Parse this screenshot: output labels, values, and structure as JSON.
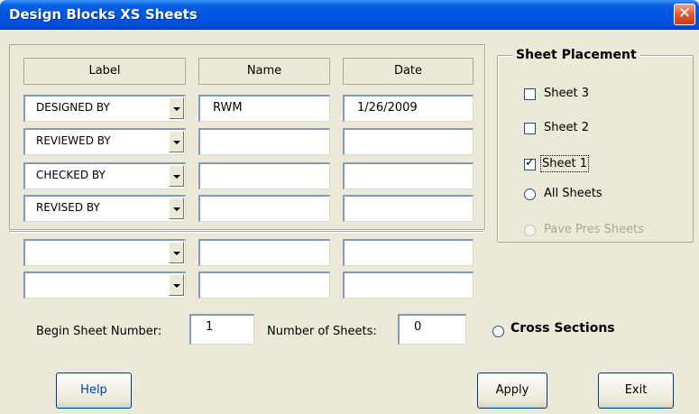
{
  "window": {
    "title": "Design Blocks XS Sheets",
    "close_glyph": "✕"
  },
  "columns": {
    "label": "Label",
    "name": "Name",
    "date": "Date"
  },
  "rows": [
    {
      "label": "DESIGNED BY",
      "name": "RWM",
      "date": "1/26/2009"
    },
    {
      "label": "REVIEWED BY",
      "name": "",
      "date": ""
    },
    {
      "label": "CHECKED BY",
      "name": "",
      "date": ""
    },
    {
      "label": "REVISED BY",
      "name": "",
      "date": ""
    },
    {
      "label": "",
      "name": "",
      "date": ""
    },
    {
      "label": "",
      "name": "",
      "date": ""
    }
  ],
  "placement": {
    "title": "Sheet Placement",
    "sheet3": {
      "label": "Sheet 3",
      "checked": false
    },
    "sheet2": {
      "label": "Sheet 2",
      "checked": false
    },
    "sheet1": {
      "label": "Sheet 1",
      "checked": true
    },
    "all_sheets": {
      "label": "All Sheets"
    },
    "pave_pres": {
      "label": "Pave Pres Sheets",
      "enabled": false
    }
  },
  "begin_sheet": {
    "label": "Begin Sheet Number:",
    "value": "1"
  },
  "num_sheets": {
    "label": "Number of Sheets:",
    "value": "0"
  },
  "cross_sections": {
    "label": "Cross Sections"
  },
  "buttons": {
    "help": "Help",
    "apply": "Apply",
    "exit": "Exit"
  },
  "colors": {
    "title_bar": "#0054e3",
    "dialog_bg": "#ece9d8",
    "help_text": "#0044aa",
    "disabled": "#aca899"
  }
}
